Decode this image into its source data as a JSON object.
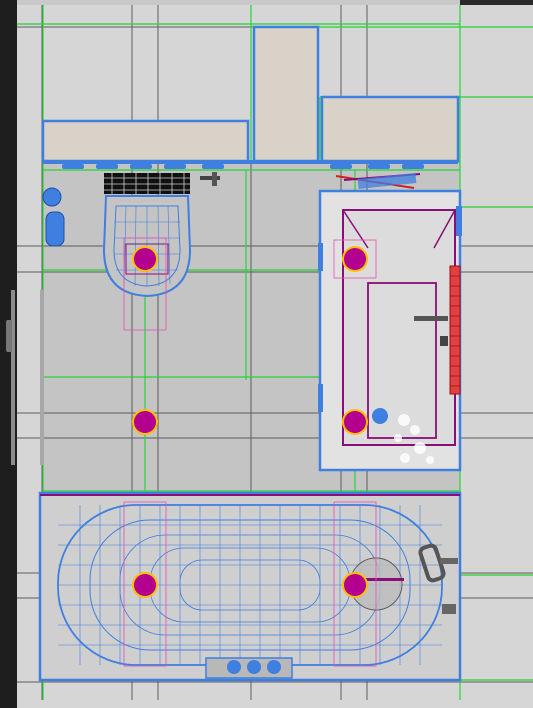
{
  "viewport": {
    "view": "top-down",
    "mode": "wireframe-shaded"
  },
  "colors": {
    "floor": "#c6c6c6",
    "wall_frame": "#d8d8d8",
    "object_edge": "#3f7fe0",
    "grid_green": "#2bd03a",
    "grid_dark": "#606060",
    "light_magenta": "#b3008f",
    "light_ring": "#ffbf00",
    "selection_purple": "#8a0e78",
    "radiator_red": "#cf2020",
    "background_dark": "#1e1e1e"
  },
  "objects": {
    "cabinets": "wall-cabinets",
    "toilet": "toilet",
    "shower": "shower-cabin",
    "bathtub": "bathtub",
    "door": "door",
    "radiator": "radiator",
    "lights": "ceiling-lights"
  }
}
